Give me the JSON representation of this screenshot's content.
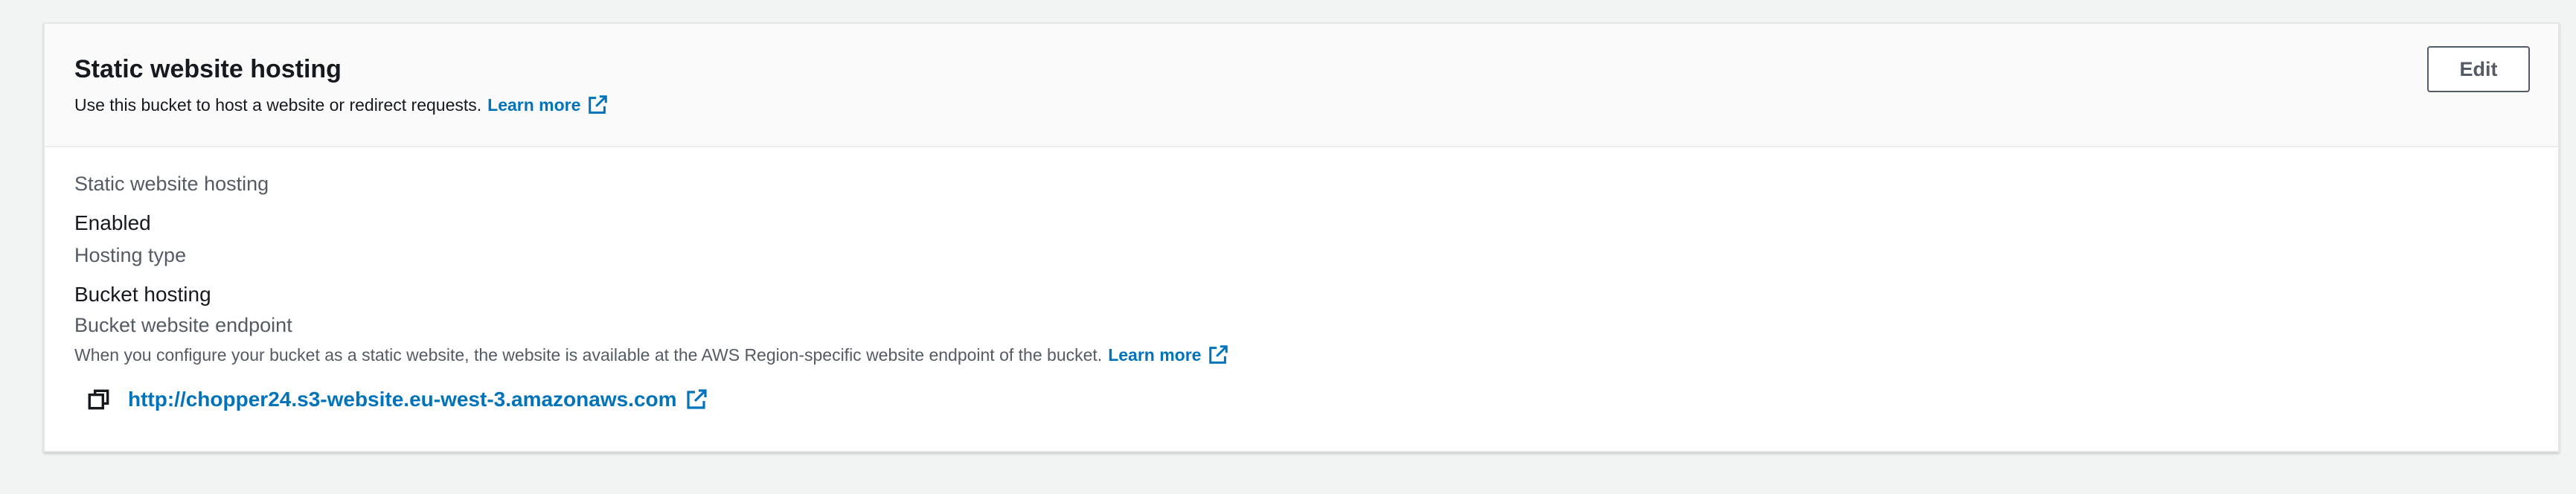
{
  "panel": {
    "title": "Static website hosting",
    "description": "Use this bucket to host a website or redirect requests.",
    "learn_more": "Learn more",
    "edit_label": "Edit"
  },
  "fields": {
    "static_hosting_label": "Static website hosting",
    "static_hosting_value": "Enabled",
    "hosting_type_label": "Hosting type",
    "hosting_type_value": "Bucket hosting",
    "endpoint_label": "Bucket website endpoint",
    "endpoint_description": "When you configure your bucket as a static website, the website is available at the AWS Region-specific website endpoint of the bucket.",
    "endpoint_learn_more": "Learn more",
    "endpoint_url": "http://chopper24.s3-website.eu-west-3.amazonaws.com"
  },
  "icons": {
    "external_link": "external-link-icon",
    "copy": "copy-icon"
  },
  "colors": {
    "link": "#0073bb",
    "text": "#16191f",
    "secondary_text": "#545b64",
    "header_bg": "#fafafa",
    "page_bg": "#f2f3f3"
  }
}
